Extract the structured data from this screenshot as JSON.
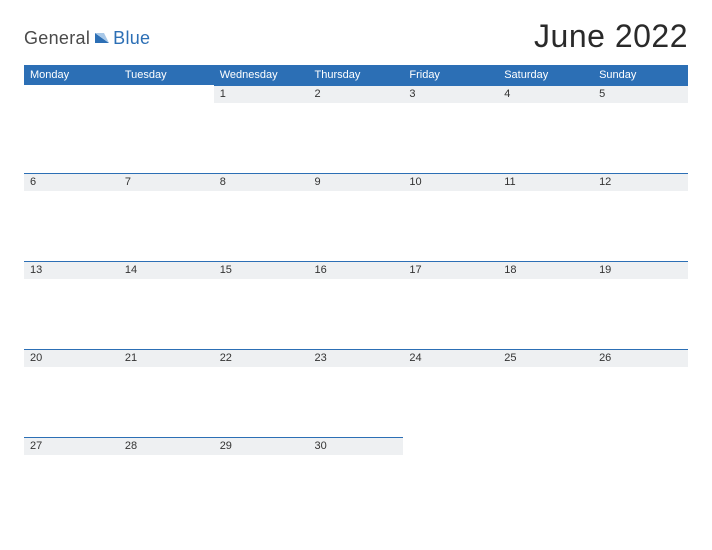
{
  "logo": {
    "general": "General",
    "blue": "Blue"
  },
  "title": "June 2022",
  "days": [
    "Monday",
    "Tuesday",
    "Wednesday",
    "Thursday",
    "Friday",
    "Saturday",
    "Sunday"
  ],
  "weeks": [
    [
      "",
      "",
      "1",
      "2",
      "3",
      "4",
      "5"
    ],
    [
      "6",
      "7",
      "8",
      "9",
      "10",
      "11",
      "12"
    ],
    [
      "13",
      "14",
      "15",
      "16",
      "17",
      "18",
      "19"
    ],
    [
      "20",
      "21",
      "22",
      "23",
      "24",
      "25",
      "26"
    ],
    [
      "27",
      "28",
      "29",
      "30",
      "",
      "",
      ""
    ]
  ]
}
